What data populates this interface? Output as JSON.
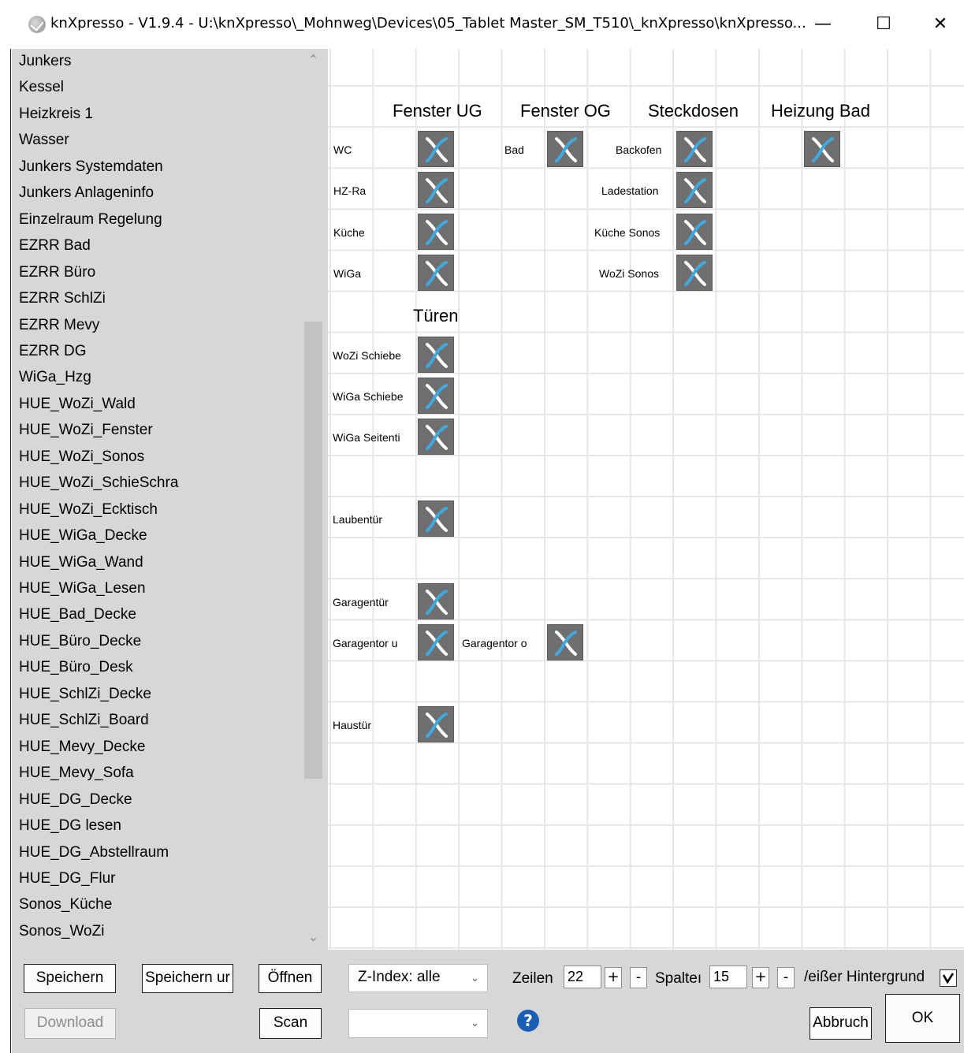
{
  "window": {
    "title": "knXpresso - V1.9.4 - U:\\knXpresso\\_Mohnweg\\Devices\\05_Tablet Master_SM_T510\\_knXpresso\\knXpresso...",
    "minimize": "—",
    "maximize": "☐",
    "close": "✕"
  },
  "device_list": [
    "Junkers",
    "Kessel",
    "Heizkreis 1",
    "Wasser",
    "Junkers Systemdaten",
    "Junkers Anlageninfo",
    "Einzelraum Regelung",
    "EZRR Bad",
    "EZRR Büro",
    "EZRR SchlZi",
    "EZRR Mevy",
    "EZRR DG",
    "WiGa_Hzg",
    "HUE_WoZi_Wald",
    "HUE_WoZi_Fenster",
    "HUE_WoZi_Sonos",
    "HUE_WoZi_SchieSchra",
    "HUE_WoZi_Ecktisch",
    "HUE_WiGa_Decke",
    "HUE_WiGa_Wand",
    "HUE_WiGa_Lesen",
    "HUE_Bad_Decke",
    "HUE_Büro_Decke",
    "HUE_Büro_Desk",
    "HUE_SchlZi_Decke",
    "HUE_SchlZi_Board",
    "HUE_Mevy_Decke",
    "HUE_Mevy_Sofa",
    "HUE_DG_Decke",
    "HUE_DG lesen",
    "HUE_DG_Abstellraum",
    "HUE_DG_Flur",
    "Sonos_Küche",
    "Sonos_WoZi"
  ],
  "scrollbar": {
    "up": "⌃",
    "down": "⌄"
  },
  "grid": {
    "headings": {
      "fenster_ug": "Fenster UG",
      "fenster_og": "Fenster OG",
      "steckdosen": "Steckdosen",
      "heizung_bad": "Heizung Bad",
      "tueren": "Türen"
    },
    "labels": {
      "wc": "WC",
      "hz_raum": "HZ-Ra",
      "kueche": "Küche",
      "wiga": "WiGa",
      "bad": "Bad",
      "backofen": "Backofen",
      "ladestation": "Ladestation",
      "kueche_sonos": "Küche Sonos",
      "wozi_sonos": "WoZi Sonos",
      "wozi_schiebe": "WoZi Schiebe",
      "wiga_schiebe": "WiGa Schiebe",
      "wiga_seitentuer": "WiGa Seitenti",
      "laubentuer": "Laubentür",
      "garagentuer": "Garagentür",
      "garagentor_ug": "Garagentor u",
      "garagentor_og": "Garagentor o",
      "haustuer": "Haustür"
    },
    "icon_name": "knxpresso-tile-icon"
  },
  "toolbar": {
    "save": "Speichern",
    "save_as": "Speichern ur",
    "open": "Öffnen",
    "z_index": "Z-Index: alle",
    "rows_label": "Zeilen",
    "rows_value": "22",
    "columns_label": "Spalteı",
    "columns_value": "15",
    "plus": "+",
    "minus": "-",
    "white_bg_label": "/eißer Hintergrund",
    "checkbox_checked": true,
    "download": "Download",
    "scan": "Scan",
    "second_combo": "",
    "help": "?",
    "cancel": "Abbruch",
    "ok": "OK",
    "combo_arrow": "⌄",
    "check_mark": "✔"
  }
}
